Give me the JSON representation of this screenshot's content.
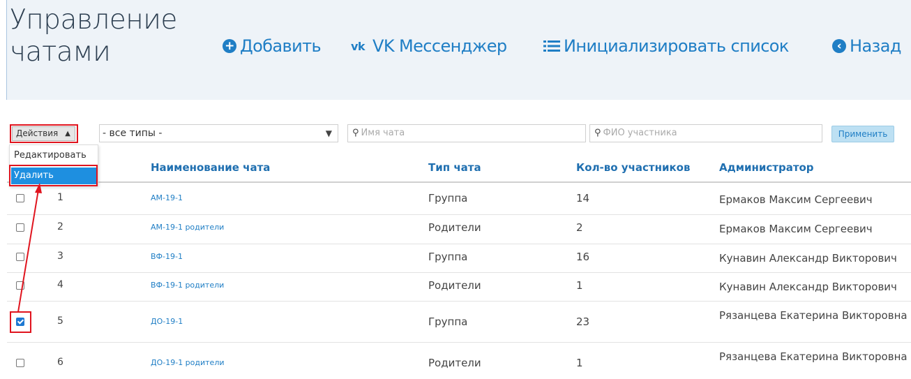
{
  "header": {
    "title": "Управление чатами",
    "add": "Добавить",
    "vk": "VK Мессенджер",
    "init": "Инициализировать список",
    "back": "Назад"
  },
  "filters": {
    "actions_label": "Действия",
    "type_value": "- все типы -",
    "chat_name_placeholder": "Имя чата",
    "member_placeholder": "ФИО участника",
    "apply_label": "Применить"
  },
  "actions_menu": {
    "items": [
      "Редактировать",
      "Удалить"
    ],
    "selected_index": 1
  },
  "table": {
    "columns": [
      "Наименование чата",
      "Тип чата",
      "Кол-во участников",
      "Администратор"
    ],
    "rows": [
      {
        "num": "1",
        "name": "АМ-19-1",
        "type": "Группа",
        "count": "14",
        "admin": "Ермаков Максим Сергеевич",
        "checked": false
      },
      {
        "num": "2",
        "name": "АМ-19-1 родители",
        "type": "Родители",
        "count": "2",
        "admin": "Ермаков Максим Сергеевич",
        "checked": false
      },
      {
        "num": "3",
        "name": "ВФ-19-1",
        "type": "Группа",
        "count": "16",
        "admin": "Кунавин Александр Викторович",
        "checked": false
      },
      {
        "num": "4",
        "name": "ВФ-19-1 родители",
        "type": "Родители",
        "count": "1",
        "admin": "Кунавин Александр Викторович",
        "checked": false
      },
      {
        "num": "5",
        "name": "ДО-19-1",
        "type": "Группа",
        "count": "23",
        "admin": "Рязанцева Екатерина Викторовна",
        "checked": true
      },
      {
        "num": "6",
        "name": "ДО-19-1 родители",
        "type": "Родители",
        "count": "1",
        "admin": "Рязанцева Екатерина Викторовна",
        "checked": false
      }
    ]
  },
  "colors": {
    "accent": "#1f7ec5",
    "highlight": "#e0141e",
    "menu_selected": "#1e8fe0"
  },
  "icons": {
    "add": "plus-circle-icon",
    "vk": "vk-logo-icon",
    "init": "list-icon",
    "back": "arrow-left-circle-icon"
  }
}
